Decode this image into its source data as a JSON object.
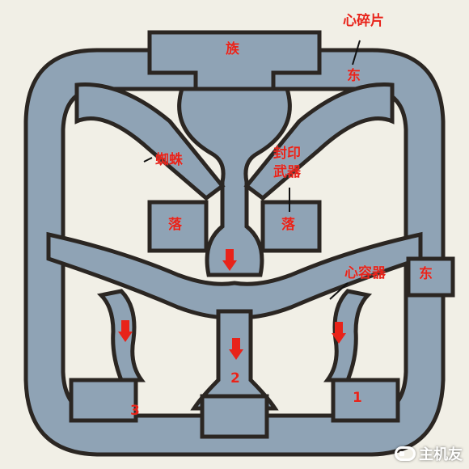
{
  "colors": {
    "background": "#f1efe6",
    "corridor": "#8fa3b5",
    "corridor_outline": "#2b2622",
    "marker": "#e8231a"
  },
  "labels": {
    "top_room": "族",
    "heart_piece": "心碎片",
    "east_top": "东",
    "east_right": "东",
    "spider": "蜘蛛",
    "sealed_weapon_line1": "封印",
    "sealed_weapon_line2": "武器",
    "drop_left": "落",
    "drop_right": "落",
    "heart_container": "心容器",
    "num_1": "1",
    "num_2": "2",
    "num_3": "3"
  },
  "markers": [
    {
      "name": "down-arrow-center-top",
      "icon": "down-arrow-icon"
    },
    {
      "name": "down-arrow-left",
      "icon": "down-arrow-icon"
    },
    {
      "name": "down-arrow-center-bottom",
      "icon": "down-arrow-icon"
    },
    {
      "name": "down-arrow-right",
      "icon": "down-arrow-icon"
    }
  ],
  "watermark": {
    "text": "主机友",
    "icon": "gamepad-icon"
  }
}
